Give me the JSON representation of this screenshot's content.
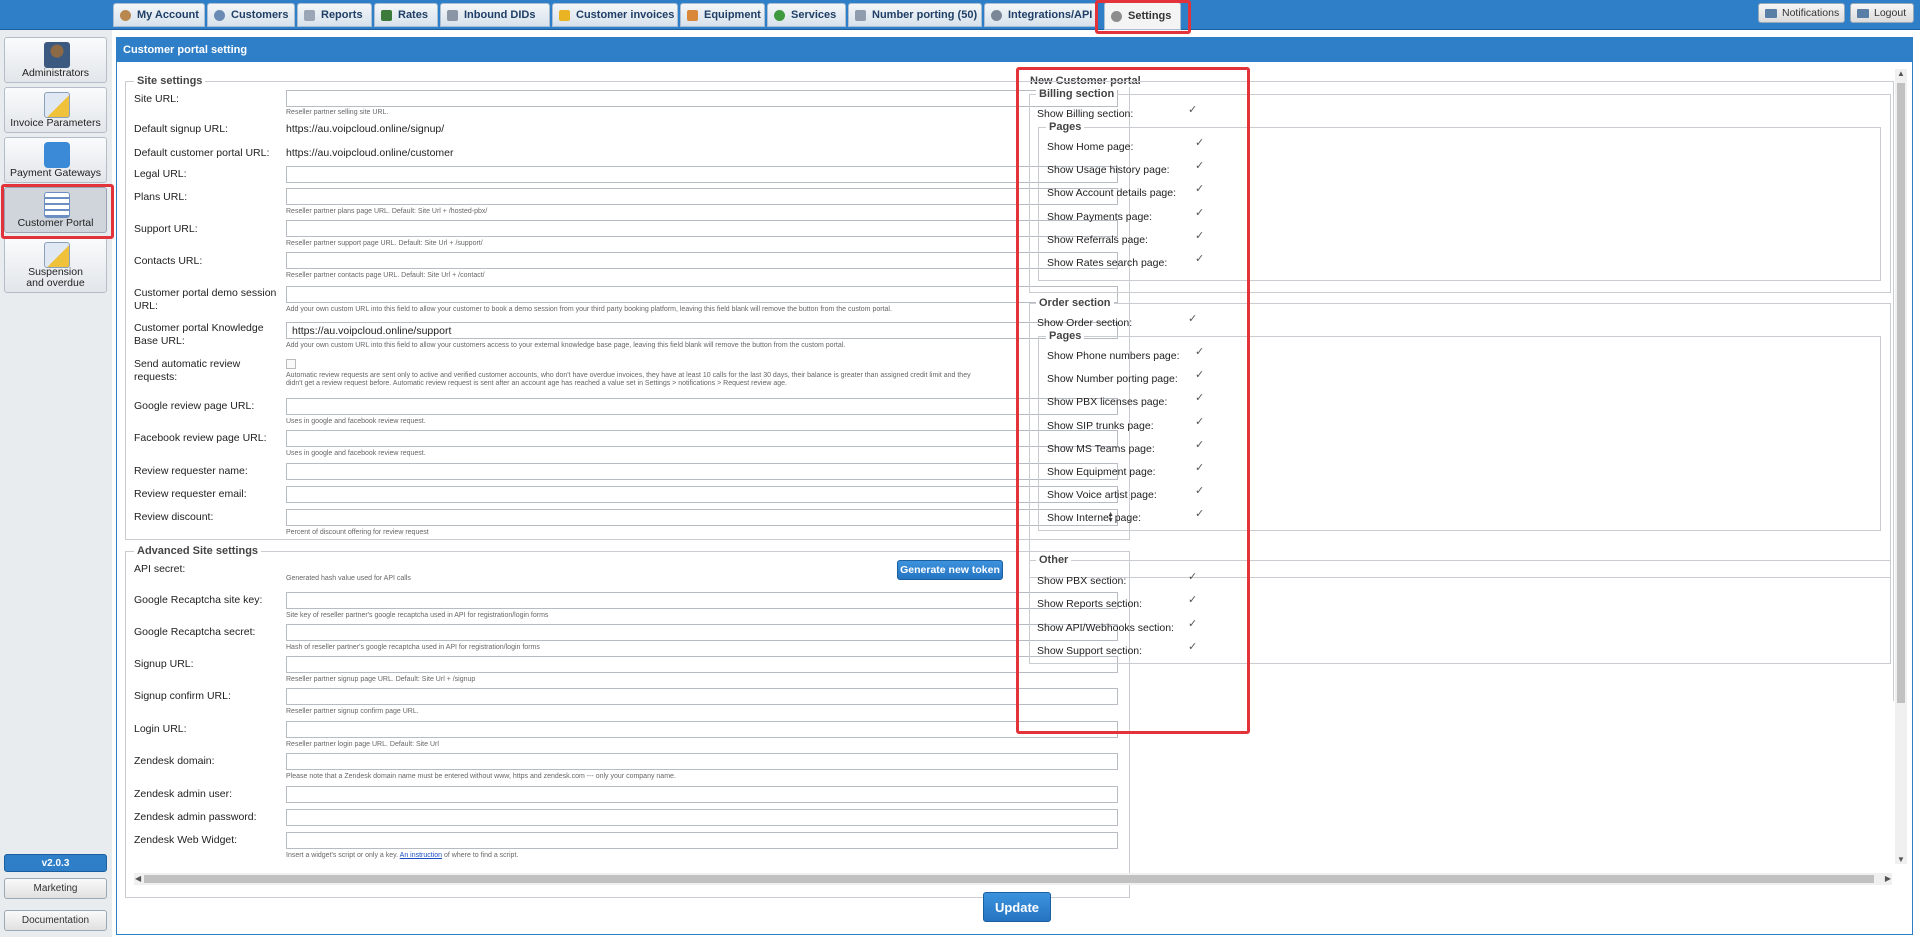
{
  "topnav": {
    "tabs": [
      {
        "label": "My Account",
        "icon": "user-icon"
      },
      {
        "label": "Customers",
        "icon": "customers-icon"
      },
      {
        "label": "Reports",
        "icon": "reports-icon"
      },
      {
        "label": "Rates",
        "icon": "rates-icon"
      },
      {
        "label": "Inbound DIDs",
        "icon": "inbound-dids-icon"
      },
      {
        "label": "Customer invoices",
        "icon": "invoices-icon"
      },
      {
        "label": "Equipment",
        "icon": "equipment-icon"
      },
      {
        "label": "Services",
        "icon": "services-icon"
      },
      {
        "label": "Number porting (50)",
        "icon": "porting-icon"
      },
      {
        "label": "Integrations/API",
        "icon": "integrations-icon"
      },
      {
        "label": "Settings",
        "icon": "settings-icon"
      }
    ],
    "notifications": "Notifications",
    "logout": "Logout"
  },
  "sidebar": {
    "items": [
      {
        "label": "Administrators",
        "icon": "administrators-icon"
      },
      {
        "label": "Invoice Parameters",
        "icon": "invoice-parameters-icon"
      },
      {
        "label": "Payment Gateways",
        "icon": "payment-gateways-icon"
      },
      {
        "label": "Customer Portal",
        "icon": "customer-portal-icon"
      },
      {
        "label": "Suspension and overdue",
        "icon": "suspension-icon"
      }
    ],
    "version": "v2.0.3",
    "marketing": "Marketing",
    "documentation": "Documentation"
  },
  "panel": {
    "title": "Customer portal setting",
    "update": "Update"
  },
  "site_settings": {
    "legend": "Site settings",
    "site_url": {
      "label": "Site URL:",
      "hint": "Reseller partner selling site URL."
    },
    "default_signup": {
      "label": "Default signup URL:",
      "value": "https://au.voipcloud.online/signup/"
    },
    "default_portal": {
      "label": "Default customer portal URL:",
      "value": "https://au.voipcloud.online/customer"
    },
    "legal_url": {
      "label": "Legal URL:"
    },
    "plans_url": {
      "label": "Plans URL:",
      "hint": "Reseller partner plans page URL. Default: Site Url + /hosted-pbx/"
    },
    "support_url": {
      "label": "Support URL:",
      "hint": "Reseller partner support page URL. Default: Site Url + /support/"
    },
    "contacts_url": {
      "label": "Contacts URL:",
      "hint": "Reseller partner contacts page URL. Default: Site Url + /contact/"
    },
    "demo_session": {
      "label1": "Customer portal demo session",
      "label2": "URL:",
      "hint": "Add your own custom URL into this field to allow your customer to book a demo session from your third party booking platform, leaving this field blank will remove the button from the custom portal."
    },
    "kb_url": {
      "label1": "Customer portal Knowledge",
      "label2": "Base URL:",
      "value": "https://au.voipcloud.online/support",
      "hint": "Add your own custom URL into this field to allow your customers access to your external knowledge base page, leaving this field blank will remove the button from the custom portal."
    },
    "auto_review": {
      "label1": "Send automatic review",
      "label2": "requests:",
      "hint1": "Automatic review requests are sent only to active and verified customer accounts, who don't have overdue invoices, they have at least 10 calls for the last 30 days, their balance is greater than assigned credit limit and they",
      "hint2": "didn't get a review request before. Automatic review request is sent after an account age has reached a value set in Settings > notifications > Request review age."
    },
    "google_review": {
      "label": "Google review page URL:",
      "hint": "Uses in google and facebook review request."
    },
    "facebook_review": {
      "label": "Facebook review page URL:",
      "hint": "Uses in google and facebook review request."
    },
    "reviewer_name": {
      "label": "Review requester name:"
    },
    "reviewer_email": {
      "label": "Review requester email:"
    },
    "review_discount": {
      "label": "Review discount:",
      "hint": "Percent of discount offering for review request"
    }
  },
  "advanced": {
    "legend": "Advanced Site settings",
    "api_secret": {
      "label": "API secret:",
      "hint": "Generated hash value used for API calls",
      "button": "Generate new token"
    },
    "recaptcha_key": {
      "label": "Google Recaptcha site key:",
      "hint": "Site key of reseller partner's google recaptcha used in API for registration/login forms"
    },
    "recaptcha_secret": {
      "label": "Google Recaptcha secret:",
      "hint": "Hash of reseller partner's google recaptcha used in API for registration/login forms"
    },
    "signup_url": {
      "label": "Signup URL:",
      "hint": "Reseller partner signup page URL. Default: Site Url + /signup"
    },
    "signup_confirm": {
      "label": "Signup confirm URL:",
      "hint": "Reseller partner signup confirm page URL."
    },
    "login_url": {
      "label": "Login URL:",
      "hint": "Reseller partner login page URL. Default: Site Url"
    },
    "zendesk_domain": {
      "label": "Zendesk domain:",
      "hint": "Please note that a Zendesk domain name must be entered without www, https and zendesk.com --- only your company name."
    },
    "zendesk_user": {
      "label": "Zendesk admin user:"
    },
    "zendesk_password": {
      "label": "Zendesk admin password:"
    },
    "zendesk_widget": {
      "label": "Zendesk Web Widget:",
      "hint_pre": "Insert a widget's script or only a key. ",
      "hint_link": "An instruction",
      "hint_post": " of where to find a script."
    }
  },
  "new_portal": {
    "legend": "New Customer portal",
    "billing": {
      "legend": "Billing section",
      "show_label": "Show Billing section:",
      "pages_legend": "Pages",
      "pages": [
        "Show Home page:",
        "Show Usage history page:",
        "Show Account details page:",
        "Show Payments page:",
        "Show Referrals page:",
        "Show Rates search page:"
      ]
    },
    "order": {
      "legend": "Order section",
      "show_label": "Show Order section:",
      "pages_legend": "Pages",
      "pages": [
        "Show Phone numbers page:",
        "Show Number porting page:",
        "Show PBX licenses page:",
        "Show SIP trunks page:",
        "Show MS Teams page:",
        "Show Equipment page:",
        "Show Voice artist page:",
        "Show Internet page:"
      ]
    },
    "other": {
      "legend": "Other",
      "items": [
        "Show PBX section:",
        "Show Reports section:",
        "Show API/Webhooks section:",
        "Show Support section:"
      ]
    }
  }
}
